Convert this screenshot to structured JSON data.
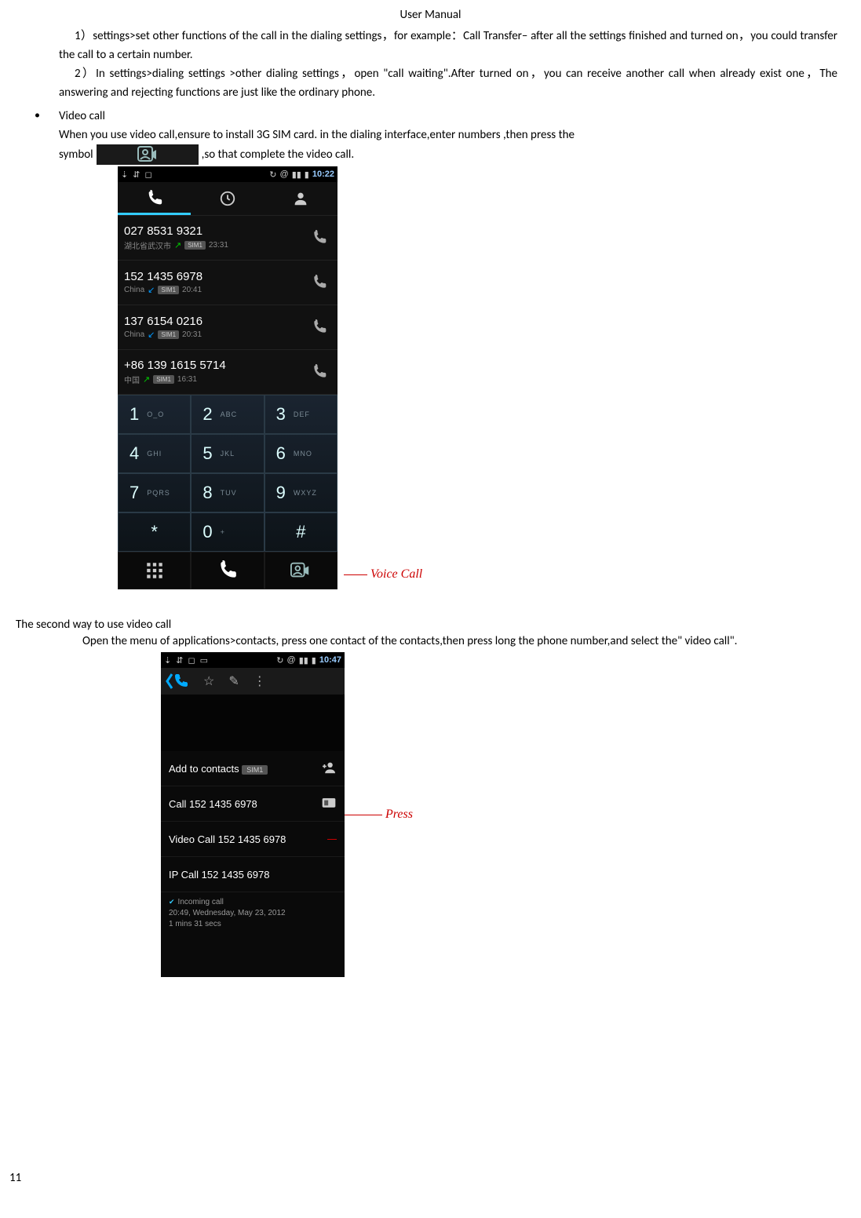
{
  "header": "User    Manual",
  "para1": "1）settings>set other functions of the call in the dialing settings，for example：Call Transfer– after all the settings finished and turned on，you could transfer the call to a certain number.",
  "para2": "2）In settings>dialing settings >other dialing settings，open  \"call waiting\".After turned on，you can receive another call when already exist one，The answering and rejecting functions are just like the ordinary phone.",
  "bullet_title": "Video call",
  "para3": "When you use video call,ensure to install 3G SIM card. in the dialing interface,enter numbers ,then press the",
  "symbol_label_pre": "symbol",
  "symbol_label_post": ",so that complete the video call.",
  "phone1": {
    "clock": "10:22",
    "calls": [
      {
        "num": "027 8531 9321",
        "sub": "湖北省武汉市",
        "dir": "out",
        "time": "23:31"
      },
      {
        "num": "152 1435 6978",
        "sub": "China",
        "dir": "in",
        "time": "20:41"
      },
      {
        "num": "137 6154 0216",
        "sub": "China",
        "dir": "in",
        "time": "20:31"
      },
      {
        "num": "+86 139 1615 5714",
        "sub": "中国",
        "dir": "out",
        "time": "16:31"
      }
    ],
    "keys": [
      {
        "d": "1",
        "l": "O_O"
      },
      {
        "d": "2",
        "l": "ABC"
      },
      {
        "d": "3",
        "l": "DEF"
      },
      {
        "d": "4",
        "l": "GHI"
      },
      {
        "d": "5",
        "l": "JKL"
      },
      {
        "d": "6",
        "l": "MNO"
      },
      {
        "d": "7",
        "l": "PQRS"
      },
      {
        "d": "8",
        "l": "TUV"
      },
      {
        "d": "9",
        "l": "WXYZ"
      },
      {
        "d": "*",
        "l": ""
      },
      {
        "d": "0",
        "l": "+"
      },
      {
        "d": "#",
        "l": ""
      }
    ],
    "annot": "Voice Call"
  },
  "section2_title": "The second way to use video call",
  "para4": "Open the menu of applications>contacts, press  one contact of the contacts,then press long the phone number,and select the\" video call\".",
  "phone2": {
    "clock": "10:47",
    "items": [
      {
        "label": "Add to contacts",
        "suffix_badge": true,
        "right": "person"
      },
      {
        "label": "Call 152 1435 6978",
        "right": "sim"
      },
      {
        "label": "Video Call 152 1435 6978",
        "right": "line"
      },
      {
        "label": "IP Call 152 1435 6978",
        "right": ""
      }
    ],
    "log_title": "Incoming call",
    "log_line1": "20:49, Wednesday, May 23, 2012",
    "log_line2": "1 mins 31 secs",
    "annot": "Press"
  },
  "page_number": "11"
}
